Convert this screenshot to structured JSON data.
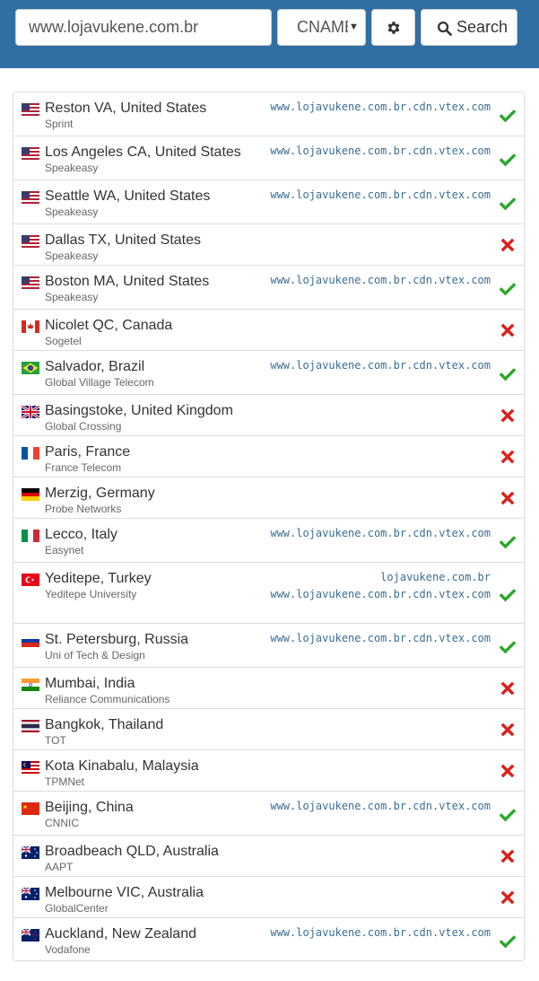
{
  "header": {
    "search_value": "www.lojavukene.com.br",
    "record_type": "CNAME",
    "search_label": "Search",
    "settings_icon": "gear-icon",
    "search_icon": "search-icon"
  },
  "colors": {
    "header_bg": "#2f6fa3",
    "ok": "#2aa82a",
    "fail": "#d9201c",
    "result_text": "#3a6e96"
  },
  "results": [
    {
      "location": "Reston VA, United States",
      "isp": "Sprint",
      "flag": "us",
      "answers": [
        "www.lojavukene.com.br.cdn.vtex.com"
      ],
      "status": "ok"
    },
    {
      "location": "Los Angeles CA, United States",
      "isp": "Speakeasy",
      "flag": "us",
      "answers": [
        "www.lojavukene.com.br.cdn.vtex.com"
      ],
      "status": "ok"
    },
    {
      "location": "Seattle WA, United States",
      "isp": "Speakeasy",
      "flag": "us",
      "answers": [
        "www.lojavukene.com.br.cdn.vtex.com"
      ],
      "status": "ok"
    },
    {
      "location": "Dallas TX, United States",
      "isp": "Speakeasy",
      "flag": "us",
      "answers": [],
      "status": "fail"
    },
    {
      "location": "Boston MA, United States",
      "isp": "Speakeasy",
      "flag": "us",
      "answers": [
        "www.lojavukene.com.br.cdn.vtex.com"
      ],
      "status": "ok"
    },
    {
      "location": "Nicolet QC, Canada",
      "isp": "Sogetel",
      "flag": "ca",
      "answers": [],
      "status": "fail"
    },
    {
      "location": "Salvador, Brazil",
      "isp": "Global Village Telecom",
      "flag": "br",
      "answers": [
        "www.lojavukene.com.br.cdn.vtex.com"
      ],
      "status": "ok"
    },
    {
      "location": "Basingstoke, United Kingdom",
      "isp": "Global Crossing",
      "flag": "gb",
      "answers": [],
      "status": "fail"
    },
    {
      "location": "Paris, France",
      "isp": "France Telecom",
      "flag": "fr",
      "answers": [],
      "status": "fail"
    },
    {
      "location": "Merzig, Germany",
      "isp": "Probe Networks",
      "flag": "de",
      "answers": [],
      "status": "fail"
    },
    {
      "location": "Lecco, Italy",
      "isp": "Easynet",
      "flag": "it",
      "answers": [
        "www.lojavukene.com.br.cdn.vtex.com"
      ],
      "status": "ok"
    },
    {
      "location": "Yeditepe, Turkey",
      "isp": "Yeditepe University",
      "flag": "tr",
      "answers": [
        "lojavukene.com.br",
        "www.lojavukene.com.br.cdn.vtex.com"
      ],
      "status": "ok"
    },
    {
      "location": "St. Petersburg, Russia",
      "isp": "Uni of Tech & Design",
      "flag": "ru",
      "answers": [
        "www.lojavukene.com.br.cdn.vtex.com"
      ],
      "status": "ok"
    },
    {
      "location": "Mumbai, India",
      "isp": "Reliance Communications",
      "flag": "in",
      "answers": [],
      "status": "fail"
    },
    {
      "location": "Bangkok, Thailand",
      "isp": "TOT",
      "flag": "th",
      "answers": [],
      "status": "fail"
    },
    {
      "location": "Kota Kinabalu, Malaysia",
      "isp": "TPMNet",
      "flag": "my",
      "answers": [],
      "status": "fail"
    },
    {
      "location": "Beijing, China",
      "isp": "CNNIC",
      "flag": "cn",
      "answers": [
        "www.lojavukene.com.br.cdn.vtex.com"
      ],
      "status": "ok"
    },
    {
      "location": "Broadbeach QLD, Australia",
      "isp": "AAPT",
      "flag": "au",
      "answers": [],
      "status": "fail"
    },
    {
      "location": "Melbourne VIC, Australia",
      "isp": "GlobalCenter",
      "flag": "au",
      "answers": [],
      "status": "fail"
    },
    {
      "location": "Auckland, New Zealand",
      "isp": "Vodafone",
      "flag": "nz",
      "answers": [
        "www.lojavukene.com.br.cdn.vtex.com"
      ],
      "status": "ok"
    }
  ]
}
